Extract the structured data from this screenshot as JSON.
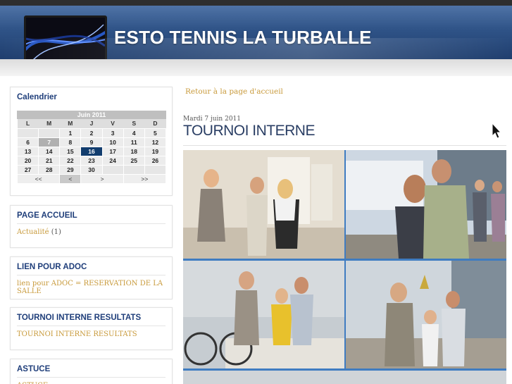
{
  "site": {
    "title": "ESTO TENNIS LA TURBALLE"
  },
  "calendar": {
    "heading": "Calendrier",
    "month": "Juin 2011",
    "weekdays": [
      "L",
      "M",
      "M",
      "J",
      "V",
      "S",
      "D"
    ],
    "weeks": [
      [
        "",
        "",
        "1",
        "2",
        "3",
        "4",
        "5"
      ],
      [
        "6",
        "7",
        "8",
        "9",
        "10",
        "11",
        "12"
      ],
      [
        "13",
        "14",
        "15",
        "16",
        "17",
        "18",
        "19"
      ],
      [
        "20",
        "21",
        "22",
        "23",
        "24",
        "25",
        "26"
      ],
      [
        "27",
        "28",
        "29",
        "30",
        "",
        "",
        ""
      ]
    ],
    "nav": [
      "<<",
      "<",
      ">",
      ">>"
    ]
  },
  "widgets": {
    "accueil": {
      "heading": "PAGE ACCUEIL",
      "link": "Actualité",
      "count": "(1)"
    },
    "adoc": {
      "heading": "LIEN POUR ADOC",
      "link": "lien pour ADOC = RESERVATION DE LA SALLE"
    },
    "tournoi": {
      "heading": "TOURNOI INTERNE RESULTATS",
      "link": "TOURNOI INTERNE RESULTATS"
    },
    "astuce": {
      "heading": "ASTUCE",
      "link": "ASTUCE"
    }
  },
  "main": {
    "back_link": "Retour à la page d'accueil",
    "date": "Mardi 7 juin 2011",
    "title": "TOURNOI INTERNE"
  },
  "colors": {
    "header_blue": "#2f5387",
    "title_navy": "#2a3e64",
    "link_gold": "#c89a3b",
    "photo_border": "#3f7cc1"
  }
}
